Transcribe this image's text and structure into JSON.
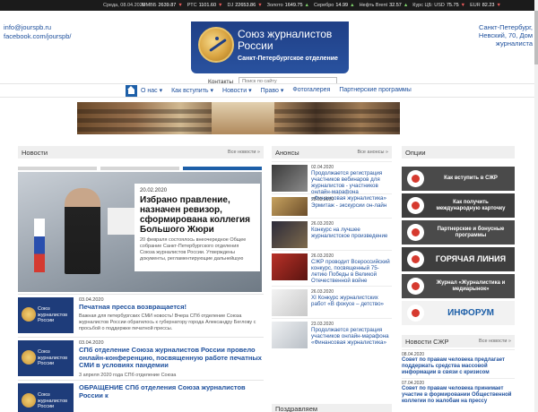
{
  "ticker": {
    "date": "Среда, 08.04.2020",
    "items": [
      {
        "name": "ММВБ",
        "value": "2639.87",
        "dir": "down"
      },
      {
        "name": "РТС",
        "value": "1101.60",
        "dir": "down"
      },
      {
        "name": "DJ",
        "value": "22653.86",
        "dir": "down"
      },
      {
        "name": "Золото",
        "value": "1649.75",
        "dir": "up"
      },
      {
        "name": "Серебро",
        "value": "14.99",
        "dir": "up"
      },
      {
        "name": "Нефть Brent",
        "value": "32.57",
        "dir": "up"
      },
      {
        "name": "Курс ЦБ: USD",
        "value": "75.75",
        "dir": "down"
      },
      {
        "name": "EUR",
        "value": "82.23",
        "dir": "down"
      }
    ]
  },
  "header": {
    "email": "info@jourspb.ru",
    "facebook": "facebook.com/jourspb/",
    "logo_title": "Союз журналистов России",
    "logo_subtitle": "Санкт-Петербургское отделение",
    "address": "Санкт-Петербург, Невский, 70, Дом журналиста",
    "contacts_label": "Контакты",
    "search_placeholder": "Поиск по сайту"
  },
  "nav": {
    "items": [
      {
        "label": "О нас ▾",
        "active": true
      },
      {
        "label": "Как вступить ▾",
        "active": false
      },
      {
        "label": "Новости ▾",
        "active": false
      },
      {
        "label": "Право ▾",
        "active": false
      },
      {
        "label": "Фотогалерея",
        "active": false
      },
      {
        "label": "Партнерские программы",
        "active": false
      }
    ]
  },
  "columns": {
    "news": {
      "title": "Новости",
      "all": "Все новости »"
    },
    "announcements": {
      "title": "Анонсы",
      "all": "Все анонсы »"
    },
    "options": {
      "title": "Опции"
    },
    "sjr_news": {
      "title": "Новости СЖР",
      "all": "Все новости »"
    }
  },
  "slider": {
    "date": "20.02.2020",
    "title": "Избрано правление, назначен ревизор, сформирована коллегия Большого Жюри",
    "text": "20 февраля состоялось внеочередное Общее собрание Санкт-Петербургского отделения Союза журналистов России. Утверждены документы, регламентирующие дальнейшую"
  },
  "news": [
    {
      "date": "03.04.2020",
      "title": "Печатная пресса возвращается!",
      "text": "Важная для петербургских СМИ новость! Вчера СПб отделение Союза журналистов России обратилось к губернатору города Александру Беглову с просьбой о поддержке печатной прессы."
    },
    {
      "date": "03.04.2020",
      "title": "СПб отделение Союза журналистов России провело онлайн-конференцию, посвященную работе печатных СМИ в условиях пандемии",
      "text": "3 апреля 2020 года СПб отделение Союза"
    },
    {
      "date": "",
      "title": "ОБРАЩЕНИЕ СПб отделения Союза журналистов России к",
      "text": ""
    }
  ],
  "thumb_text": "Союз журналистов России",
  "announcements": [
    {
      "date": "02.04.2020",
      "title": "Продолжается регистрация участников вебинаров для журналистов - участников онлайн-марафона «Финансовая журналистика»"
    },
    {
      "date": "28.03.2020",
      "title": "Эрмитаж - экскурсии он-лайн"
    },
    {
      "date": "26.03.2020",
      "title": "Конкурс на лучшее журналистское произведение"
    },
    {
      "date": "26.03.2020",
      "title": "СЖР проводит Всероссийский конкурс, посвященный 75-летию Победы в Великой Отечественной войне"
    },
    {
      "date": "26.03.2020",
      "title": "XI Конкурс журналистских работ «В фокусе – детство»"
    },
    {
      "date": "23.03.2020",
      "title": "Продолжается регистрация участников онлайн-марафона «Финансовая журналистика»"
    }
  ],
  "announcements_more": "Поздравляем",
  "options": [
    {
      "label": "Как вступить в СЖР"
    },
    {
      "label": "Как получить международную карточку"
    },
    {
      "label": "Партнерские и бонусные программы"
    },
    {
      "label": "ГОРЯЧАЯ ЛИНИЯ"
    },
    {
      "label": "Журнал «Журналистика и медиарынок»"
    },
    {
      "label": "ИНФОРУМ"
    }
  ],
  "sjr_news": [
    {
      "date": "08.04.2020",
      "title": "Совет по правам человека предлагает поддержать средства массовой информации в связи с кризисом"
    },
    {
      "date": "07.04.2020",
      "title": "Совет по правам человека принимает участие в формировании Общественной коллегии по жалобам на прессу"
    }
  ]
}
